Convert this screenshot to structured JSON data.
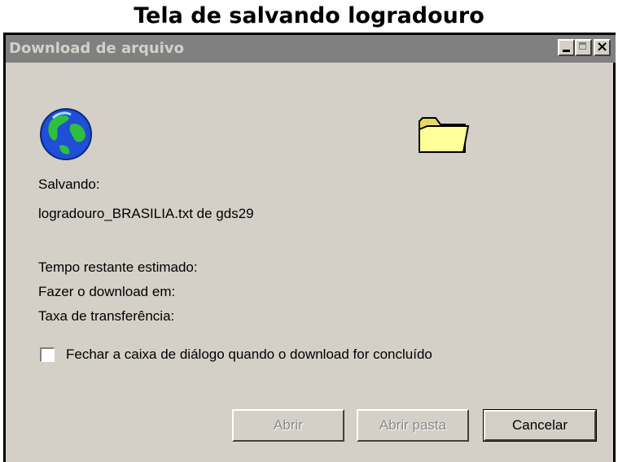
{
  "caption": "Tela de salvando logradouro",
  "window": {
    "title": "Download de arquivo"
  },
  "titlebar_buttons": {
    "close_glyph": "×"
  },
  "icons": [
    "globe-icon",
    "folder-icon"
  ],
  "body": {
    "saving_label": "Salvando:",
    "file_line": "logradouro_BRASILIA.txt de gds29",
    "time_left_label": "Tempo restante estimado:",
    "download_to_label": "Fazer o download em:",
    "transfer_rate_label": "Taxa de transferência:"
  },
  "close_checkbox": {
    "label": "Fechar a caixa de diálogo quando o download for concluído",
    "checked": false
  },
  "buttons": {
    "open": "Abrir",
    "open_folder": "Abrir pasta",
    "cancel": "Cancelar"
  },
  "colors": {
    "dialog_bg": "#d4d0c8",
    "titlebar_bg": "#808080",
    "titlebar_text": "#d4d0c8"
  }
}
